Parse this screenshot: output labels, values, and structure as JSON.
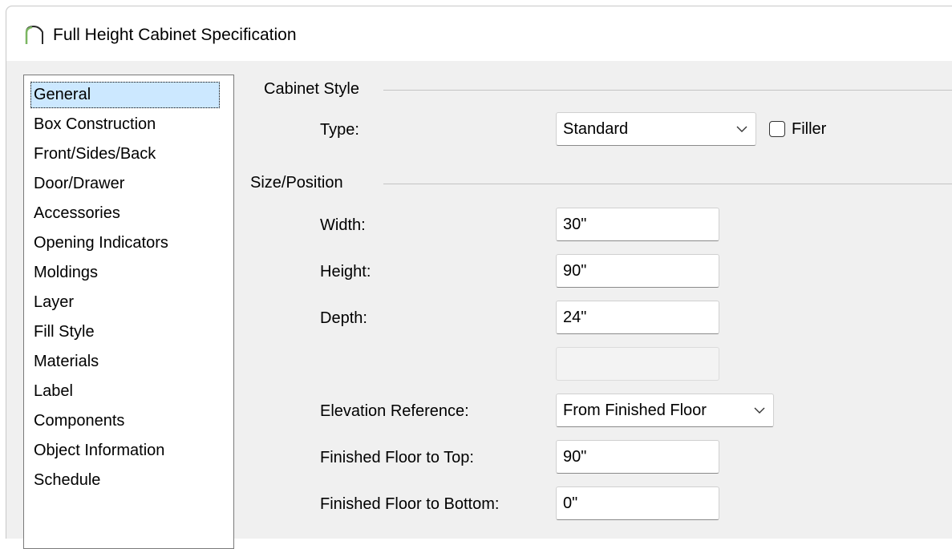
{
  "window": {
    "title": "Full Height Cabinet Specification",
    "icon": "cabinet-arch-icon"
  },
  "nav": {
    "selected": "General",
    "items": [
      "General",
      "Box Construction",
      "Front/Sides/Back",
      "Door/Drawer",
      "Accessories",
      "Opening Indicators",
      "Moldings",
      "Layer",
      "Fill Style",
      "Materials",
      "Label",
      "Components",
      "Object Information",
      "Schedule"
    ]
  },
  "cabinet_style": {
    "group_label": "Cabinet Style",
    "type_label": "Type:",
    "type_value": "Standard",
    "filler_label": "Filler",
    "filler_checked": false
  },
  "size_position": {
    "group_label": "Size/Position",
    "width_label": "Width:",
    "width_value": "30\"",
    "height_label": "Height:",
    "height_value": "90\"",
    "depth_label": "Depth:",
    "depth_value": "24\"",
    "blank_field_value": "",
    "elevation_ref_label": "Elevation Reference:",
    "elevation_ref_value": "From Finished Floor",
    "ff_top_label": "Finished Floor to Top:",
    "ff_top_value": "90\"",
    "ff_bottom_label": "Finished Floor to Bottom:",
    "ff_bottom_value": "0\""
  }
}
